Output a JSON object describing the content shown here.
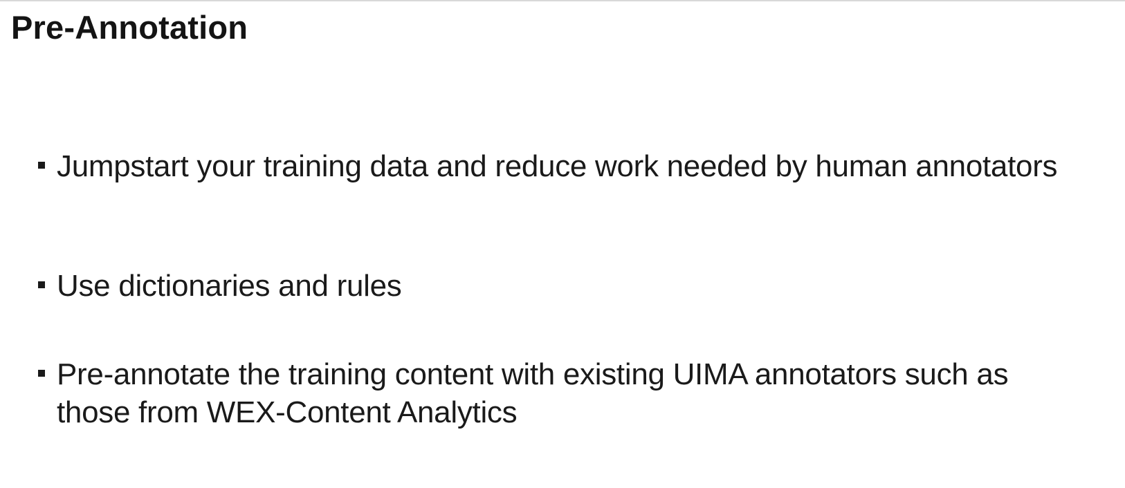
{
  "slide": {
    "title": "Pre-Annotation",
    "bullets": [
      {
        "text": "Jumpstart your training data and reduce work needed by human annotators"
      },
      {
        "text": "Use dictionaries and rules"
      },
      {
        "text": "Pre-annotate the training content with existing UIMA annotators such as those from WEX-Content Analytics"
      }
    ]
  }
}
